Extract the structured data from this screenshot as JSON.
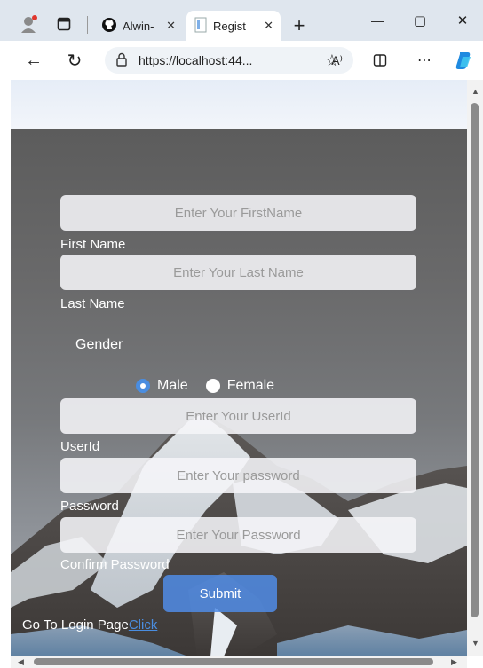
{
  "browser": {
    "tabs": [
      {
        "title": "Alwin-",
        "active": false
      },
      {
        "title": "Regist",
        "active": true
      }
    ],
    "new_tab_label": "+",
    "window_controls": {
      "minimize": "—",
      "maximize": "▢",
      "close": "✕"
    },
    "address": "https://localhost:44...",
    "reader_label": "A⁾"
  },
  "form": {
    "firstname_placeholder": "Enter Your FirstName",
    "firstname_label": "First Name",
    "lastname_placeholder": "Enter Your Last Name",
    "lastname_label": "Last Name",
    "gender_label": "Gender",
    "gender_options": [
      {
        "label": "Male",
        "checked": true
      },
      {
        "label": "Female",
        "checked": false
      }
    ],
    "userid_placeholder": "Enter Your UserId",
    "userid_label": "UserId",
    "password_placeholder": "Enter Your password",
    "password_label": "Password",
    "confirm_placeholder": "Enter Your Password",
    "confirm_label": "Confirm Password",
    "submit_label": "Submit",
    "login_prefix": "Go To Login Page",
    "login_link": "Click"
  },
  "colors": {
    "accent": "#4a8de0",
    "label_text": "#ffffff"
  }
}
